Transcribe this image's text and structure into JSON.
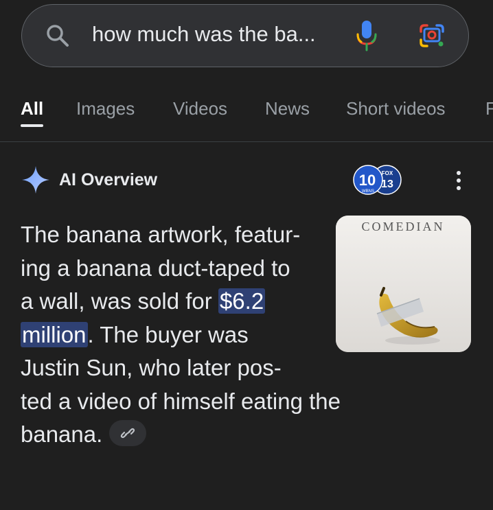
{
  "search": {
    "query": "how much was the ba..."
  },
  "tabs": [
    {
      "label": "All",
      "active": true
    },
    {
      "label": "Images",
      "active": false
    },
    {
      "label": "Videos",
      "active": false
    },
    {
      "label": "News",
      "active": false
    },
    {
      "label": "Short videos",
      "active": false
    },
    {
      "label": "F",
      "active": false
    }
  ],
  "ai_overview": {
    "title": "AI Overview",
    "source_logo": {
      "top_text": "FOX",
      "number": "13",
      "big_number": "10",
      "small_text": "WBNS"
    },
    "lines": {
      "l1": "The banana artwork, featur-",
      "l2": "ing a banana duct-taped to",
      "l3_pre": "a wall, was sold for ",
      "l3_hl": "$6.2",
      "l4_hl": "million",
      "l4_post": ". The buyer was",
      "l5": "Justin Sun, who later pos-",
      "l6": "ted a video of himself eating the",
      "l7": "banana."
    },
    "thumbnail_caption": "COMEDIAN"
  },
  "icons": {
    "search": "search-icon",
    "mic": "mic-icon",
    "lens": "google-lens-icon",
    "sparkle": "ai-sparkle-icon",
    "more": "more-vert-icon",
    "link": "link-icon"
  },
  "colors": {
    "background": "#1f1f1f",
    "search_bg": "#303134",
    "highlight_bg": "#2f4174",
    "sparkle_blue": "#8ab4f8"
  }
}
